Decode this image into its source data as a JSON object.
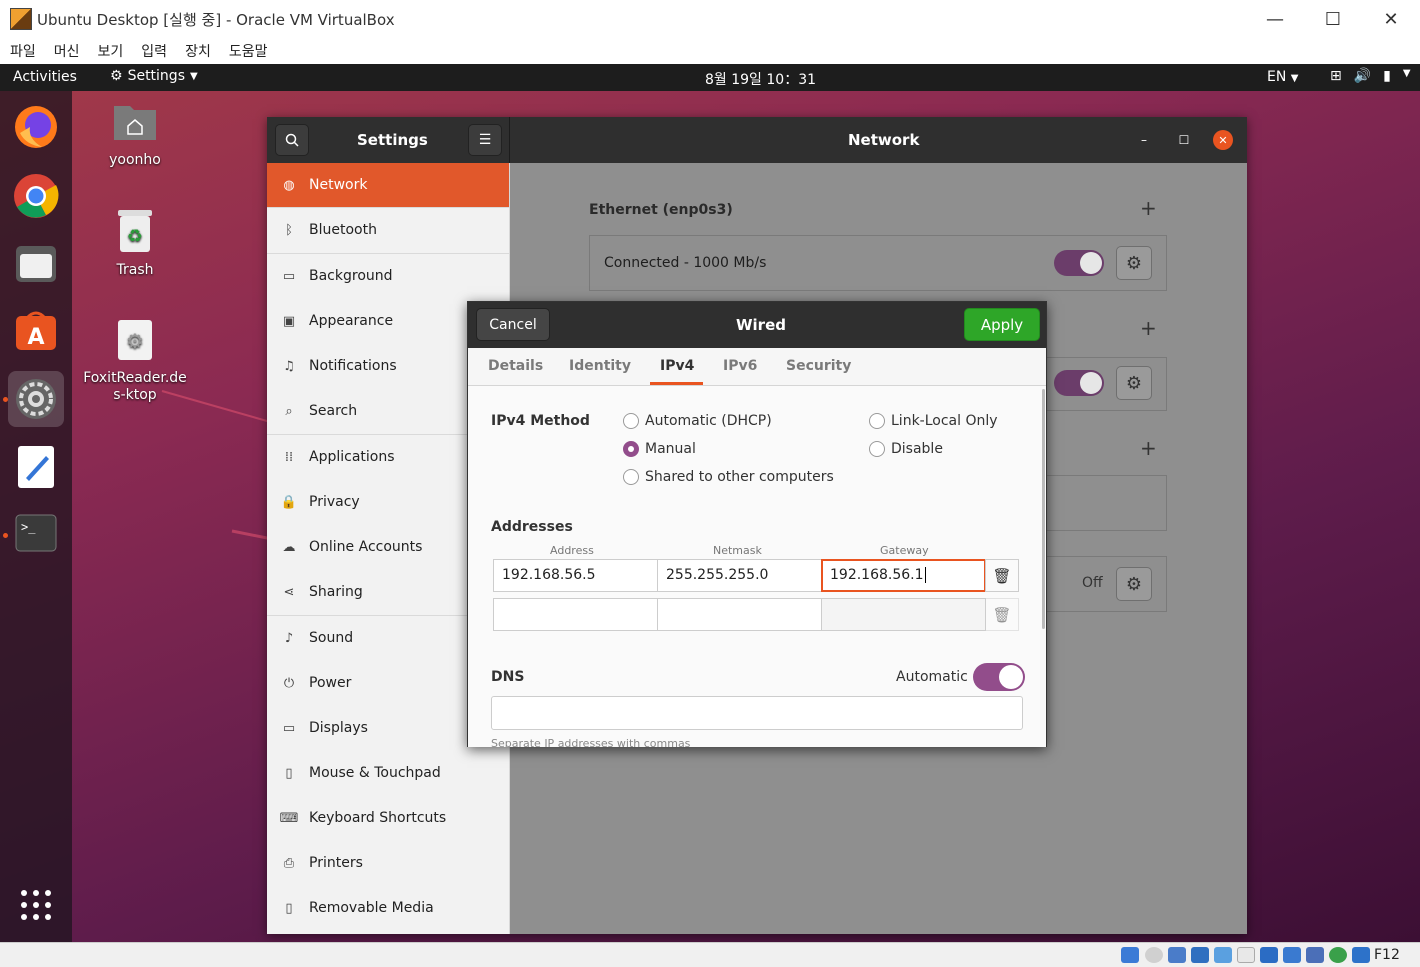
{
  "host": {
    "title": "Ubuntu Desktop [실행 중] - Oracle VM VirtualBox",
    "menu": [
      "파일",
      "머신",
      "보기",
      "입력",
      "장치",
      "도움말"
    ],
    "window_buttons": {
      "minimize": "—",
      "maximize": "☐",
      "close": "✕"
    },
    "host_key": "F12"
  },
  "topbar": {
    "activities": "Activities",
    "app_menu": "Settings",
    "clock": "8월 19일  10：31",
    "language": "EN"
  },
  "desktop": {
    "icons": [
      {
        "label": "yoonho"
      },
      {
        "label": "Trash"
      },
      {
        "label": "FoxitReader.des-ktop"
      }
    ]
  },
  "settings": {
    "title": "Settings",
    "panel_title": "Network",
    "sidebar": [
      {
        "label": "Network",
        "icon": "globe-icon"
      },
      {
        "label": "Bluetooth",
        "icon": "bluetooth-icon"
      },
      {
        "label": "Background",
        "icon": "monitor-icon"
      },
      {
        "label": "Appearance",
        "icon": "appearance-icon"
      },
      {
        "label": "Notifications",
        "icon": "bell-icon"
      },
      {
        "label": "Search",
        "icon": "search-icon"
      },
      {
        "label": "Applications",
        "icon": "grid-icon"
      },
      {
        "label": "Privacy",
        "icon": "lock-icon"
      },
      {
        "label": "Online Accounts",
        "icon": "cloud-icon"
      },
      {
        "label": "Sharing",
        "icon": "share-icon"
      },
      {
        "label": "Sound",
        "icon": "music-note-icon"
      },
      {
        "label": "Power",
        "icon": "power-icon"
      },
      {
        "label": "Displays",
        "icon": "display-icon"
      },
      {
        "label": "Mouse & Touchpad",
        "icon": "mouse-icon"
      },
      {
        "label": "Keyboard Shortcuts",
        "icon": "keyboard-icon"
      },
      {
        "label": "Printers",
        "icon": "printer-icon"
      },
      {
        "label": "Removable Media",
        "icon": "usb-drive-icon"
      }
    ],
    "network": {
      "ethernet_title": "Ethernet (enp0s3)",
      "ethernet_status": "Connected - 1000 Mb/s",
      "proxy_status": "Off"
    }
  },
  "dialog": {
    "title": "Wired",
    "cancel": "Cancel",
    "apply": "Apply",
    "tabs": [
      "Details",
      "Identity",
      "IPv4",
      "IPv6",
      "Security"
    ],
    "active_tab": "IPv4",
    "ipv4_method_label": "IPv4 Method",
    "methods": {
      "automatic": "Automatic (DHCP)",
      "manual": "Manual",
      "shared": "Shared to other computers",
      "link_local": "Link-Local Only",
      "disable": "Disable"
    },
    "selected_method": "Manual",
    "addresses_label": "Addresses",
    "columns": [
      "Address",
      "Netmask",
      "Gateway"
    ],
    "rows": [
      {
        "address": "192.168.56.5",
        "netmask": "255.255.255.0",
        "gateway": "192.168.56.1"
      },
      {
        "address": "",
        "netmask": "",
        "gateway": ""
      }
    ],
    "dns_label": "DNS",
    "dns_automatic_label": "Automatic",
    "dns_automatic": true,
    "dns_value": "",
    "dns_hint": "Separate IP addresses with commas"
  },
  "colors": {
    "accent": "#e95420",
    "toggle_on": "#924d8b",
    "apply_green": "#2ea628"
  }
}
